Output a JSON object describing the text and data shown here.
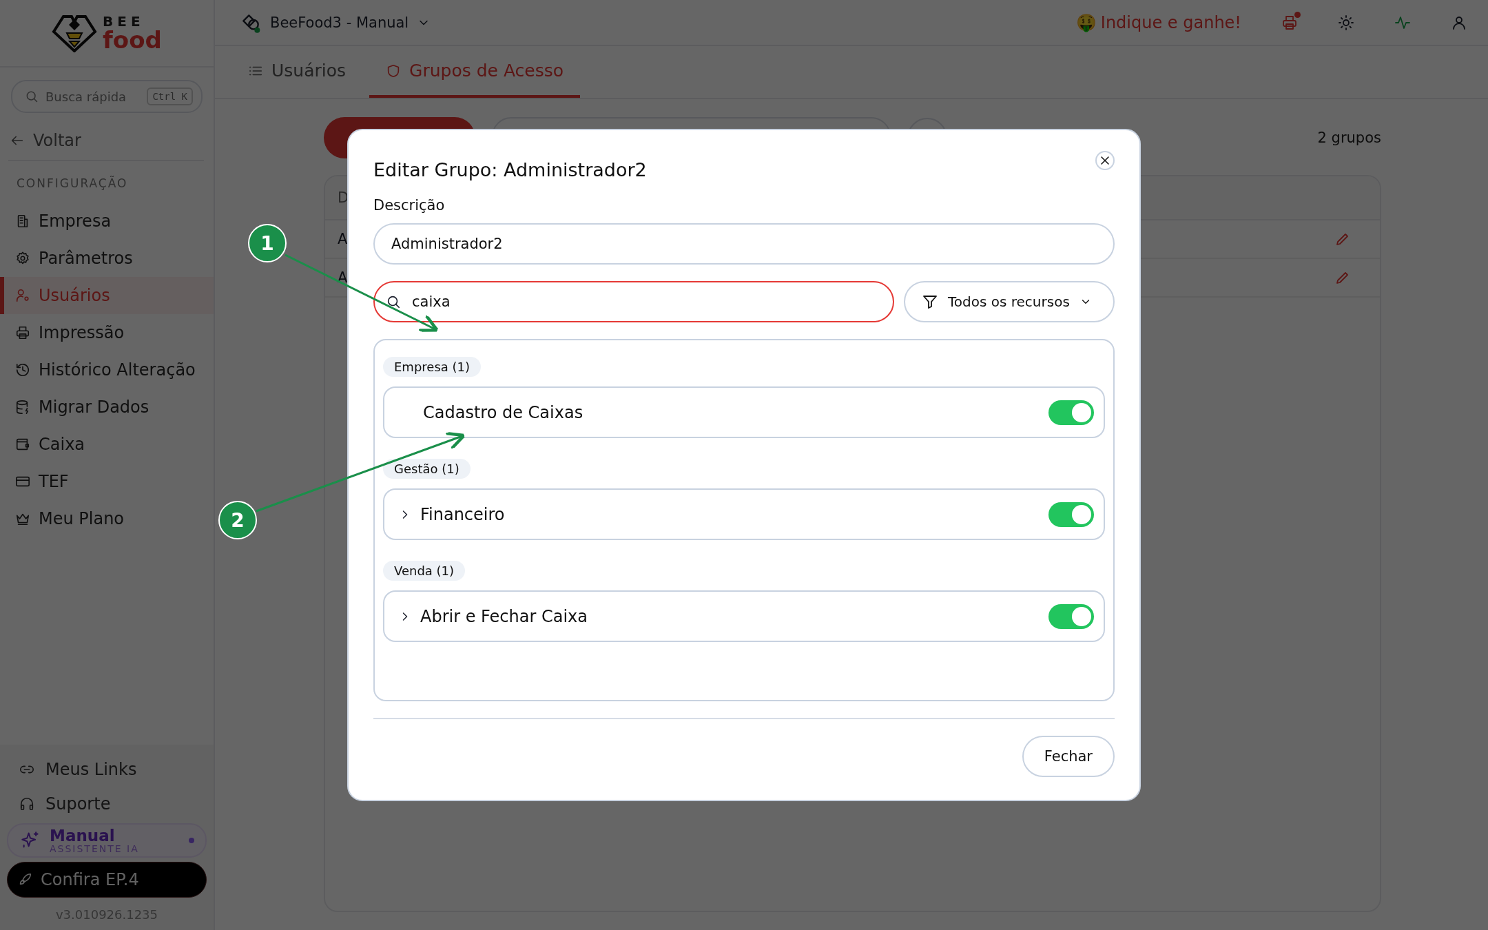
{
  "logo": {
    "top": "BEE",
    "bottom": "food"
  },
  "header": {
    "workspace": "BeeFood3 - Manual",
    "referral": "Indique e ganhe!",
    "emoji": "🤑",
    "notification": true
  },
  "sidebar": {
    "search": {
      "placeholder": "Busca rápida",
      "shortcut": "Ctrl K"
    },
    "back": "Voltar",
    "section": "CONFIGURAÇÃO",
    "items": [
      {
        "label": "Empresa",
        "selected": false
      },
      {
        "label": "Parâmetros",
        "selected": false
      },
      {
        "label": "Usuários",
        "selected": true
      },
      {
        "label": "Impressão",
        "selected": false
      },
      {
        "label": "Histórico Alteração",
        "selected": false
      },
      {
        "label": "Migrar Dados",
        "selected": false
      },
      {
        "label": "Caixa",
        "selected": false
      },
      {
        "label": "TEF",
        "selected": false
      },
      {
        "label": "Meu Plano",
        "selected": false
      }
    ],
    "footer_links": [
      "Meus Links",
      "Suporte"
    ],
    "assistant": {
      "title": "Manual",
      "subtitle": "ASSISTENTE IA"
    },
    "promo": "Confira EP.4",
    "version": "v3.010926.1235"
  },
  "tabs": [
    {
      "label": "Usuários",
      "selected": false
    },
    {
      "label": "Grupos de Acesso",
      "selected": true
    }
  ],
  "content": {
    "count": "2 grupos",
    "table": {
      "column_1": "D",
      "rows": [
        "A",
        "A"
      ]
    }
  },
  "modal": {
    "title": "Editar Grupo: Administrador2",
    "description_label": "Descrição",
    "description_value": "Administrador2",
    "search_value": "caixa",
    "filter": "Todos os recursos",
    "groups": [
      {
        "name": "Empresa (1)",
        "items": [
          {
            "label": "Cadastro de Caixas",
            "expandable": false,
            "on": true
          }
        ]
      },
      {
        "name": "Gestão (1)",
        "items": [
          {
            "label": "Financeiro",
            "expandable": true,
            "on": true
          }
        ]
      },
      {
        "name": "Venda (1)",
        "items": [
          {
            "label": "Abrir e Fechar Caixa",
            "expandable": true,
            "on": true
          }
        ]
      }
    ],
    "close_button": "Fechar"
  },
  "annotations": [
    {
      "label": "1"
    },
    {
      "label": "2"
    }
  ]
}
